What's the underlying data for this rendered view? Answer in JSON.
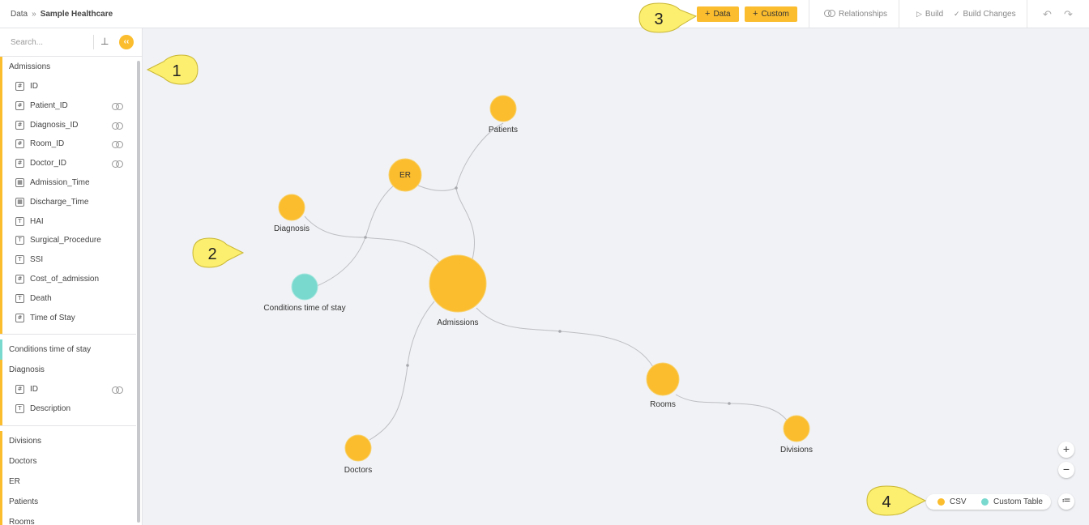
{
  "breadcrumb": {
    "root": "Data",
    "separator": "»",
    "current": "Sample Healthcare"
  },
  "toolbar": {
    "add_data_label": "Data",
    "add_custom_label": "Custom",
    "relationships_label": "Relationships",
    "build_label": "Build",
    "build_changes_label": "Build Changes",
    "undo_icon": "undo-icon",
    "redo_icon": "redo-icon"
  },
  "sidebar": {
    "search_placeholder": "Search...",
    "groups": [
      {
        "name": "Admissions",
        "kind": "csv",
        "fields": [
          {
            "name": "ID",
            "type": "#"
          },
          {
            "name": "Patient_ID",
            "type": "#",
            "linked": true
          },
          {
            "name": "Diagnosis_ID",
            "type": "#",
            "linked": true
          },
          {
            "name": "Room_ID",
            "type": "#",
            "linked": true
          },
          {
            "name": "Doctor_ID",
            "type": "#",
            "linked": true
          },
          {
            "name": "Admission_Time",
            "type": "date"
          },
          {
            "name": "Discharge_Time",
            "type": "date"
          },
          {
            "name": "HAI",
            "type": "T"
          },
          {
            "name": "Surgical_Procedure",
            "type": "T"
          },
          {
            "name": "SSI",
            "type": "T"
          },
          {
            "name": "Cost_of_admission",
            "type": "#"
          },
          {
            "name": "Death",
            "type": "T"
          },
          {
            "name": "Time of Stay",
            "type": "#+"
          }
        ]
      },
      {
        "name": "Conditions time of stay",
        "kind": "custom",
        "fields": []
      },
      {
        "name": "Diagnosis",
        "kind": "csv",
        "fields": [
          {
            "name": "ID",
            "type": "#",
            "linked": true
          },
          {
            "name": "Description",
            "type": "T"
          }
        ]
      },
      {
        "name": "Divisions",
        "kind": "csv",
        "fields": []
      },
      {
        "name": "Doctors",
        "kind": "csv",
        "fields": []
      },
      {
        "name": "ER",
        "kind": "csv",
        "fields": []
      },
      {
        "name": "Patients",
        "kind": "csv",
        "fields": []
      },
      {
        "name": "Rooms",
        "kind": "csv",
        "fields": []
      }
    ]
  },
  "graph": {
    "nodes": [
      {
        "id": "admissions",
        "label": "Admissions",
        "kind": "csv"
      },
      {
        "id": "patients",
        "label": "Patients",
        "kind": "csv"
      },
      {
        "id": "er",
        "label": "ER",
        "kind": "csv"
      },
      {
        "id": "diagnosis",
        "label": "Diagnosis",
        "kind": "csv"
      },
      {
        "id": "conditions",
        "label": "Conditions time of stay",
        "kind": "custom"
      },
      {
        "id": "rooms",
        "label": "Rooms",
        "kind": "csv"
      },
      {
        "id": "divisions",
        "label": "Divisions",
        "kind": "csv"
      },
      {
        "id": "doctors",
        "label": "Doctors",
        "kind": "csv"
      }
    ]
  },
  "callouts": [
    "1",
    "2",
    "3",
    "4"
  ],
  "legend": {
    "csv_label": "CSV",
    "custom_label": "Custom Table"
  },
  "colors": {
    "csv": "#fbbd2d",
    "custom": "#7ad9cf",
    "link": "#bdbec3"
  }
}
